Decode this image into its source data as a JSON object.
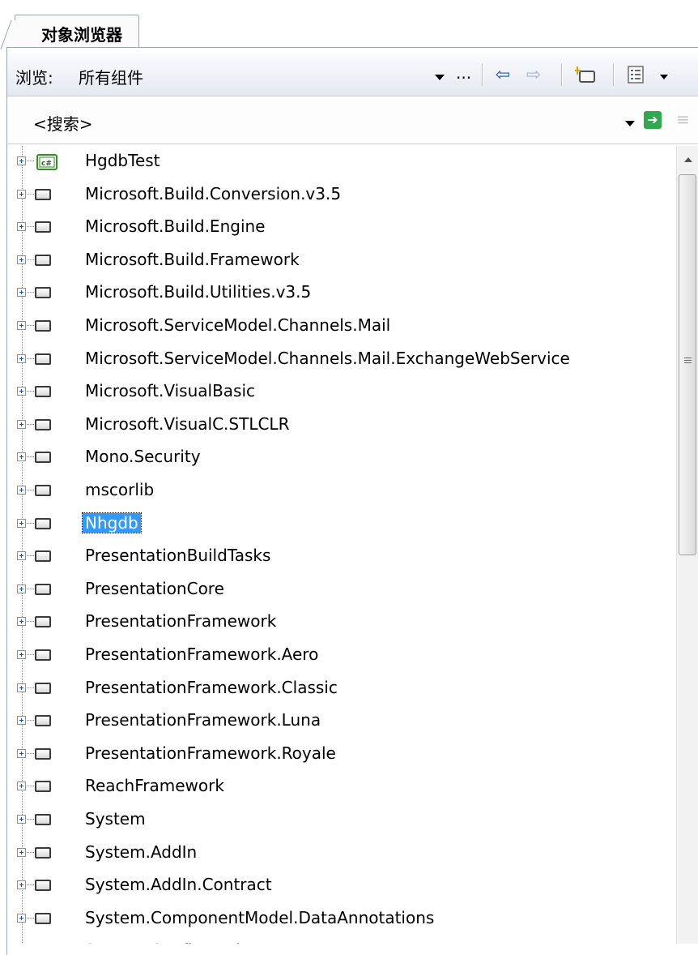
{
  "tab": {
    "title": "对象浏览器"
  },
  "toolbar": {
    "browse_label": "浏览:",
    "browse_value": "所有组件",
    "ellipsis": "..."
  },
  "search": {
    "value": "<搜索>"
  },
  "tree": {
    "items": [
      {
        "label": "HgdbTest",
        "icon": "csharp-project-icon",
        "selected": false
      },
      {
        "label": "Microsoft.Build.Conversion.v3.5",
        "icon": "assembly-icon",
        "selected": false
      },
      {
        "label": "Microsoft.Build.Engine",
        "icon": "assembly-icon",
        "selected": false
      },
      {
        "label": "Microsoft.Build.Framework",
        "icon": "assembly-icon",
        "selected": false
      },
      {
        "label": "Microsoft.Build.Utilities.v3.5",
        "icon": "assembly-icon",
        "selected": false
      },
      {
        "label": "Microsoft.ServiceModel.Channels.Mail",
        "icon": "assembly-icon",
        "selected": false
      },
      {
        "label": "Microsoft.ServiceModel.Channels.Mail.ExchangeWebService",
        "icon": "assembly-icon",
        "selected": false
      },
      {
        "label": "Microsoft.VisualBasic",
        "icon": "assembly-icon",
        "selected": false
      },
      {
        "label": "Microsoft.VisualC.STLCLR",
        "icon": "assembly-icon",
        "selected": false
      },
      {
        "label": "Mono.Security",
        "icon": "assembly-icon",
        "selected": false
      },
      {
        "label": "mscorlib",
        "icon": "assembly-icon",
        "selected": false
      },
      {
        "label": "Nhgdb",
        "icon": "assembly-icon",
        "selected": true
      },
      {
        "label": "PresentationBuildTasks",
        "icon": "assembly-icon",
        "selected": false
      },
      {
        "label": "PresentationCore",
        "icon": "assembly-icon",
        "selected": false
      },
      {
        "label": "PresentationFramework",
        "icon": "assembly-icon",
        "selected": false
      },
      {
        "label": "PresentationFramework.Aero",
        "icon": "assembly-icon",
        "selected": false
      },
      {
        "label": "PresentationFramework.Classic",
        "icon": "assembly-icon",
        "selected": false
      },
      {
        "label": "PresentationFramework.Luna",
        "icon": "assembly-icon",
        "selected": false
      },
      {
        "label": "PresentationFramework.Royale",
        "icon": "assembly-icon",
        "selected": false
      },
      {
        "label": "ReachFramework",
        "icon": "assembly-icon",
        "selected": false
      },
      {
        "label": "System",
        "icon": "assembly-icon",
        "selected": false
      },
      {
        "label": "System.AddIn",
        "icon": "assembly-icon",
        "selected": false
      },
      {
        "label": "System.AddIn.Contract",
        "icon": "assembly-icon",
        "selected": false
      },
      {
        "label": "System.ComponentModel.DataAnnotations",
        "icon": "assembly-icon",
        "selected": false
      },
      {
        "label": "System.Configuration",
        "icon": "assembly-icon",
        "selected": false
      }
    ]
  },
  "colors": {
    "selection": "#3399ff",
    "toolbar_top": "#fafbfd",
    "toolbar_bottom": "#e4e9f1",
    "border": "#9aa5b1"
  }
}
